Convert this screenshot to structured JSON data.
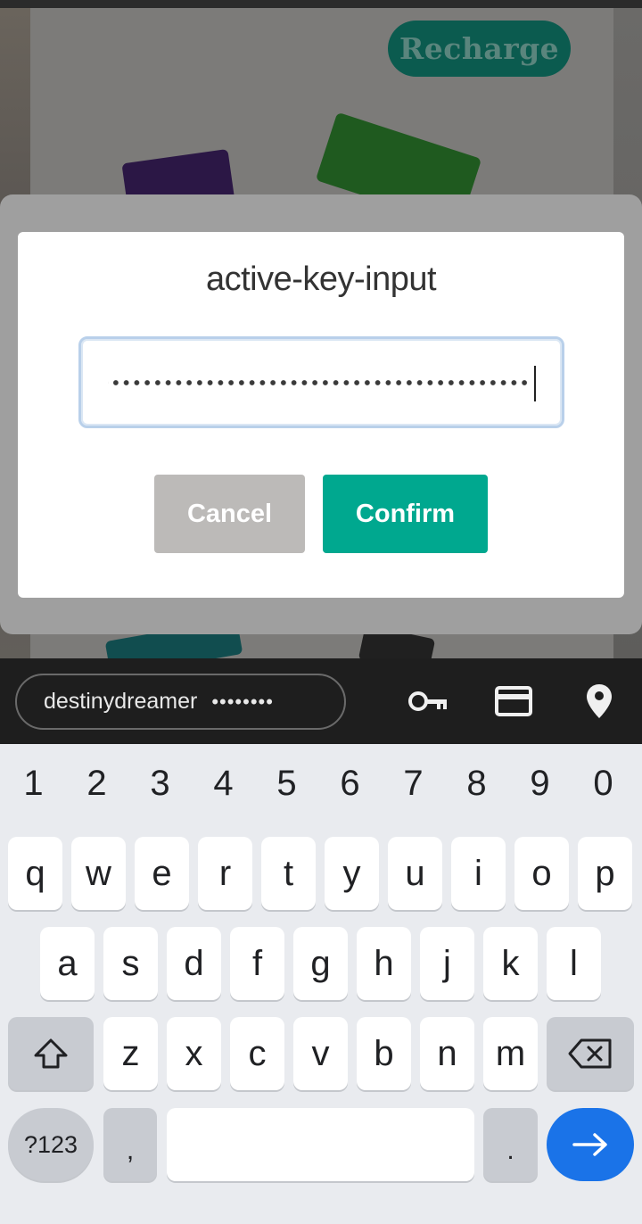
{
  "background_app": {
    "recharge_label": "Recharge"
  },
  "dialog": {
    "title": "active-key-input",
    "input_mask": "••••••••••••••••••••••••••••••••••••••••",
    "cancel_label": "Cancel",
    "confirm_label": "Confirm"
  },
  "autofill": {
    "username": "destinydreamer",
    "password_mask": "••••••••",
    "icons": [
      "key-icon",
      "credit-card-icon",
      "location-pin-icon"
    ]
  },
  "keyboard": {
    "number_row": [
      "1",
      "2",
      "3",
      "4",
      "5",
      "6",
      "7",
      "8",
      "9",
      "0"
    ],
    "row1": [
      "q",
      "w",
      "e",
      "r",
      "t",
      "y",
      "u",
      "i",
      "o",
      "p"
    ],
    "row2": [
      "a",
      "s",
      "d",
      "f",
      "g",
      "h",
      "j",
      "k",
      "l"
    ],
    "row3": [
      "z",
      "x",
      "c",
      "v",
      "b",
      "n",
      "m"
    ],
    "symbols_label": "?123",
    "comma_label": ",",
    "period_label": "."
  },
  "colors": {
    "confirm": "#00a88f",
    "cancel": "#bcbab8",
    "enter_key": "#1a73e8",
    "recharge": "#0b5b4f"
  }
}
